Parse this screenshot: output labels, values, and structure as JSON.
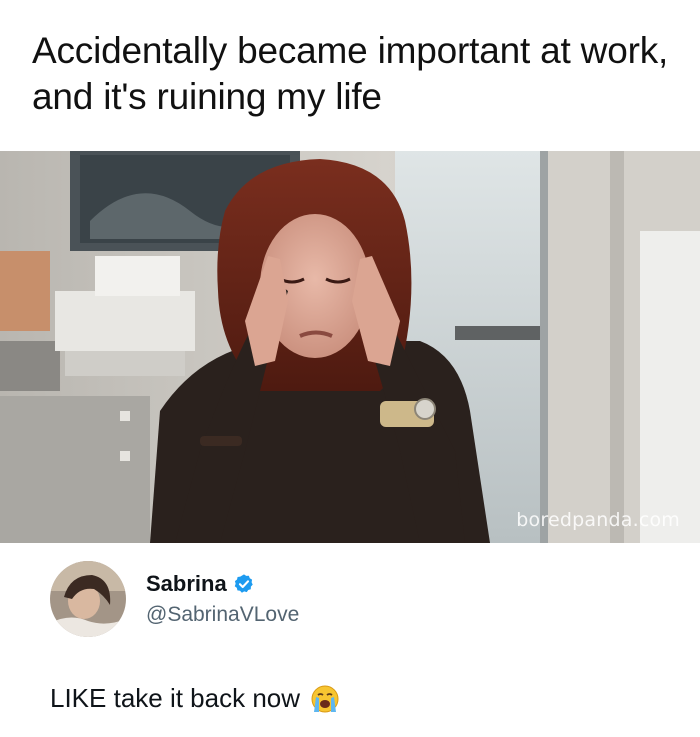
{
  "meme": {
    "caption": "Accidentally became important at work, and it's ruining my life"
  },
  "photo": {
    "watermark": "boredpanda.com"
  },
  "tweet": {
    "display_name": "Sabrina",
    "handle": "@SabrinaVLove",
    "text": "LIKE take it back now",
    "verified_icon": "verified-badge-icon",
    "emoji_icon": "loudly-crying-face-icon",
    "verified_color": "#1d9bf0"
  }
}
